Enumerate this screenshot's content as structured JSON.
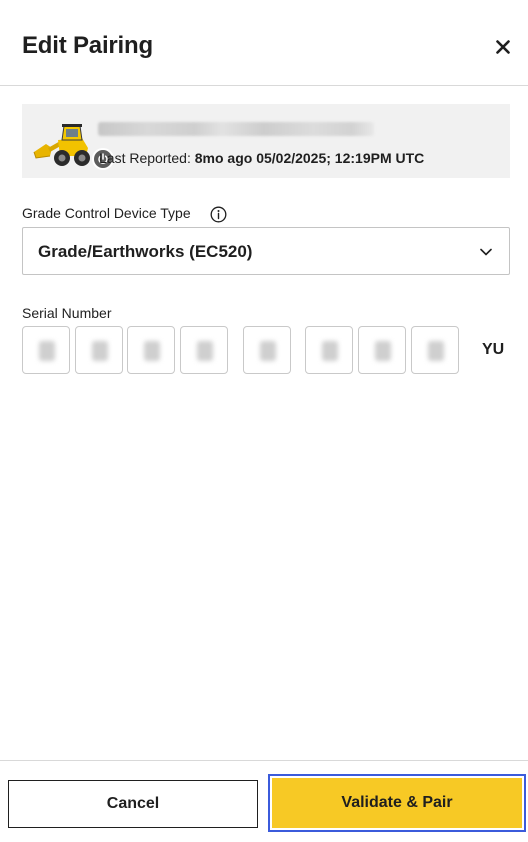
{
  "dialog": {
    "title": "Edit Pairing",
    "close_icon": "close-icon"
  },
  "asset": {
    "image_icon": "wheel-loader-icon",
    "status_icon": "power-icon",
    "name": "",
    "last_reported_label": "Last Reported:",
    "last_reported_value": "8mo ago 05/02/2025; 12:19PM UTC"
  },
  "device_type": {
    "label": "Grade Control Device Type",
    "info_icon": "info-icon",
    "selected": "Grade/Earthworks (EC520)",
    "chevron_icon": "chevron-down-icon"
  },
  "serial": {
    "label": "Serial Number",
    "digit_count": 8,
    "suffix": "YU"
  },
  "footer": {
    "cancel_label": "Cancel",
    "submit_label": "Validate & Pair"
  },
  "colors": {
    "primary": "#f7c925",
    "focus_ring": "#3b5bdb",
    "card_bg": "#f1f1f1",
    "text": "#1f1f1f"
  }
}
